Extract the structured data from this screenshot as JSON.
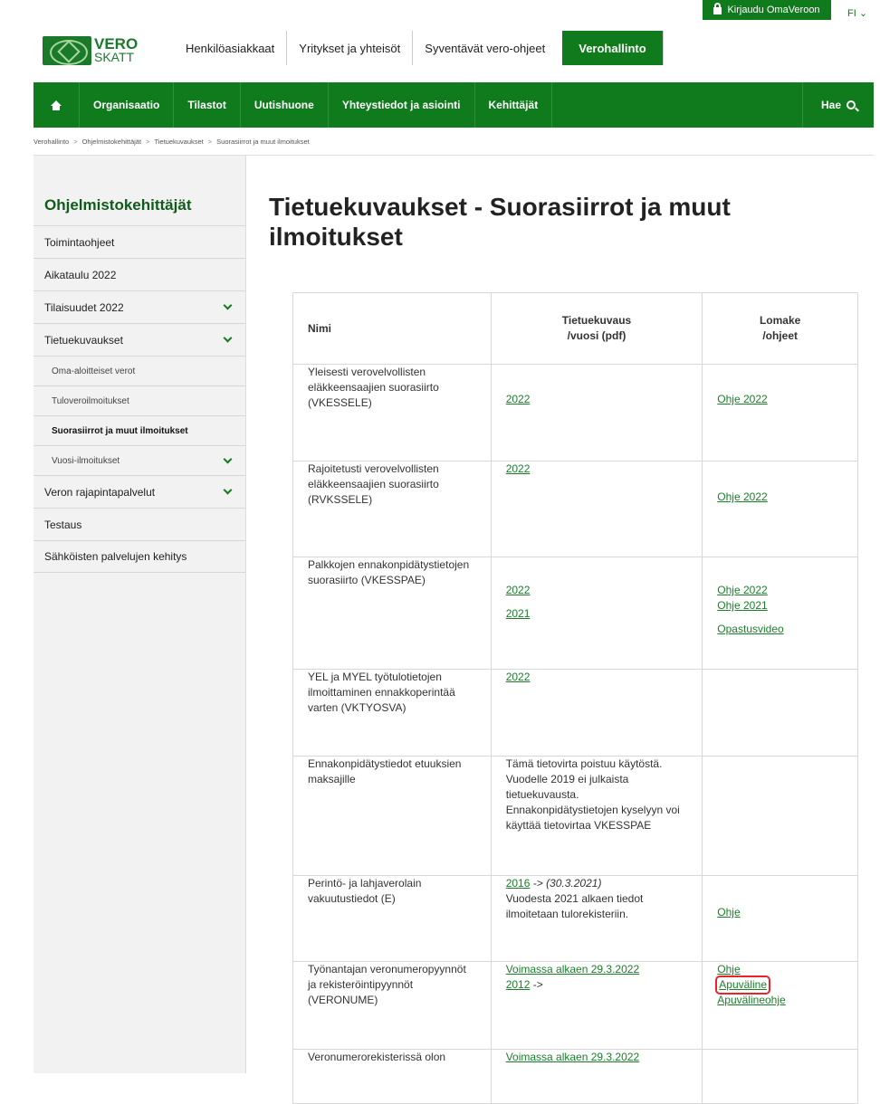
{
  "topbar": {
    "login_label": "Kirjaudu OmaVeroon",
    "language": "FI ⌄"
  },
  "logo": {
    "line1": "VERO",
    "line2": "SKATT"
  },
  "header_nav": [
    "Henkilöasiakkaat",
    "Yritykset ja yhteisöt",
    "Syventävät vero-ohjeet",
    "Verohallinto"
  ],
  "main_nav": [
    "Organisaatio",
    "Tilastot",
    "Uutishuone",
    "Yhteystiedot ja asiointi",
    "Kehittäjät"
  ],
  "search_label": "Hae",
  "breadcrumb": [
    "Verohallinto",
    "Ohjelmistokehittäjät",
    "Tietuekuvaukset",
    "Suorasiirrot ja muut ilmoitukset"
  ],
  "sidebar": {
    "title": "Ohjelmistokehittäjät",
    "items": [
      {
        "label": "Toimintaohjeet"
      },
      {
        "label": "Aikataulu 2022"
      },
      {
        "label": "Tilaisuudet 2022"
      },
      {
        "label": "Tietuekuvaukset"
      },
      {
        "label": "Oma-aloitteiset verot"
      },
      {
        "label": "Tuloveroilmoitukset"
      },
      {
        "label": "Suorasiirrot ja muut ilmoitukset"
      },
      {
        "label": "Vuosi-ilmoitukset"
      },
      {
        "label": "Veron rajapintapalvelut"
      },
      {
        "label": "Testaus"
      },
      {
        "label": "Sähköisten palvelujen kehitys"
      }
    ]
  },
  "page_title": "Tietuekuvaukset - Suorasiirrot ja muut ilmoitukset",
  "table": {
    "headers": {
      "name": "Nimi",
      "desc_1": "Tietuekuvaus",
      "desc_2": "/vuosi (pdf)",
      "form_1": "Lomake",
      "form_2": "/ohjeet"
    },
    "rows": [
      {
        "name": "Yleisesti verovelvollisten eläkkeensaajien suorasiirto (VKESSELE)",
        "desc": [
          "2022"
        ],
        "form": [
          "Ohje 2022"
        ]
      },
      {
        "name": "Rajoitetusti verovelvollisten eläkkeensaajien suorasiirto (RVKSSELE)",
        "desc": [
          "2022"
        ],
        "form": [
          "Ohje 2022"
        ]
      },
      {
        "name": "Palkkojen ennakonpidätystietojen suorasiirto (VKESSPAE)",
        "desc": [
          "2022",
          "2021"
        ],
        "form": [
          "Ohje 2022",
          "Ohje 2021",
          "Opastusvideo"
        ]
      },
      {
        "name": "YEL ja MYEL työtulotietojen ilmoittaminen ennakkoperintää varten (VKTYOSVA)",
        "desc": [
          "2022"
        ],
        "form": []
      },
      {
        "name": "Ennakonpidätystiedot etuuksien maksajille",
        "desc_text": "Tämä tietovirta poistuu käytöstä. Vuodelle 2019 ei julkaista tietuekuvausta. Ennakonpidätystietojen kyselyyn voi käyttää tietovirtaa VKESSPAE",
        "form": []
      },
      {
        "name": "Perintö- ja lahjaverolain vakuutustiedot (E)",
        "desc_link": "2016",
        "desc_suffix": " -> (30.3.2021)",
        "desc_text": "Vuodesta 2021 alkaen tiedot ilmoitetaan tulorekisteriin.",
        "form": [
          "Ohje"
        ]
      },
      {
        "name": "Työnantajan veronumeropyynnöt ja rekisteröintipyynnöt (VERONUME)",
        "desc": [
          "Voimassa alkaen 29.3.2022",
          "2012"
        ],
        "desc_suffix_2": " ->",
        "form": [
          "Ohje",
          "Apuväline",
          "Apuvälineohje"
        ]
      },
      {
        "name": "Veronumerorekisterissä olon",
        "desc": [
          "Voimassa alkaen 29.3.2022"
        ],
        "form": []
      }
    ]
  }
}
